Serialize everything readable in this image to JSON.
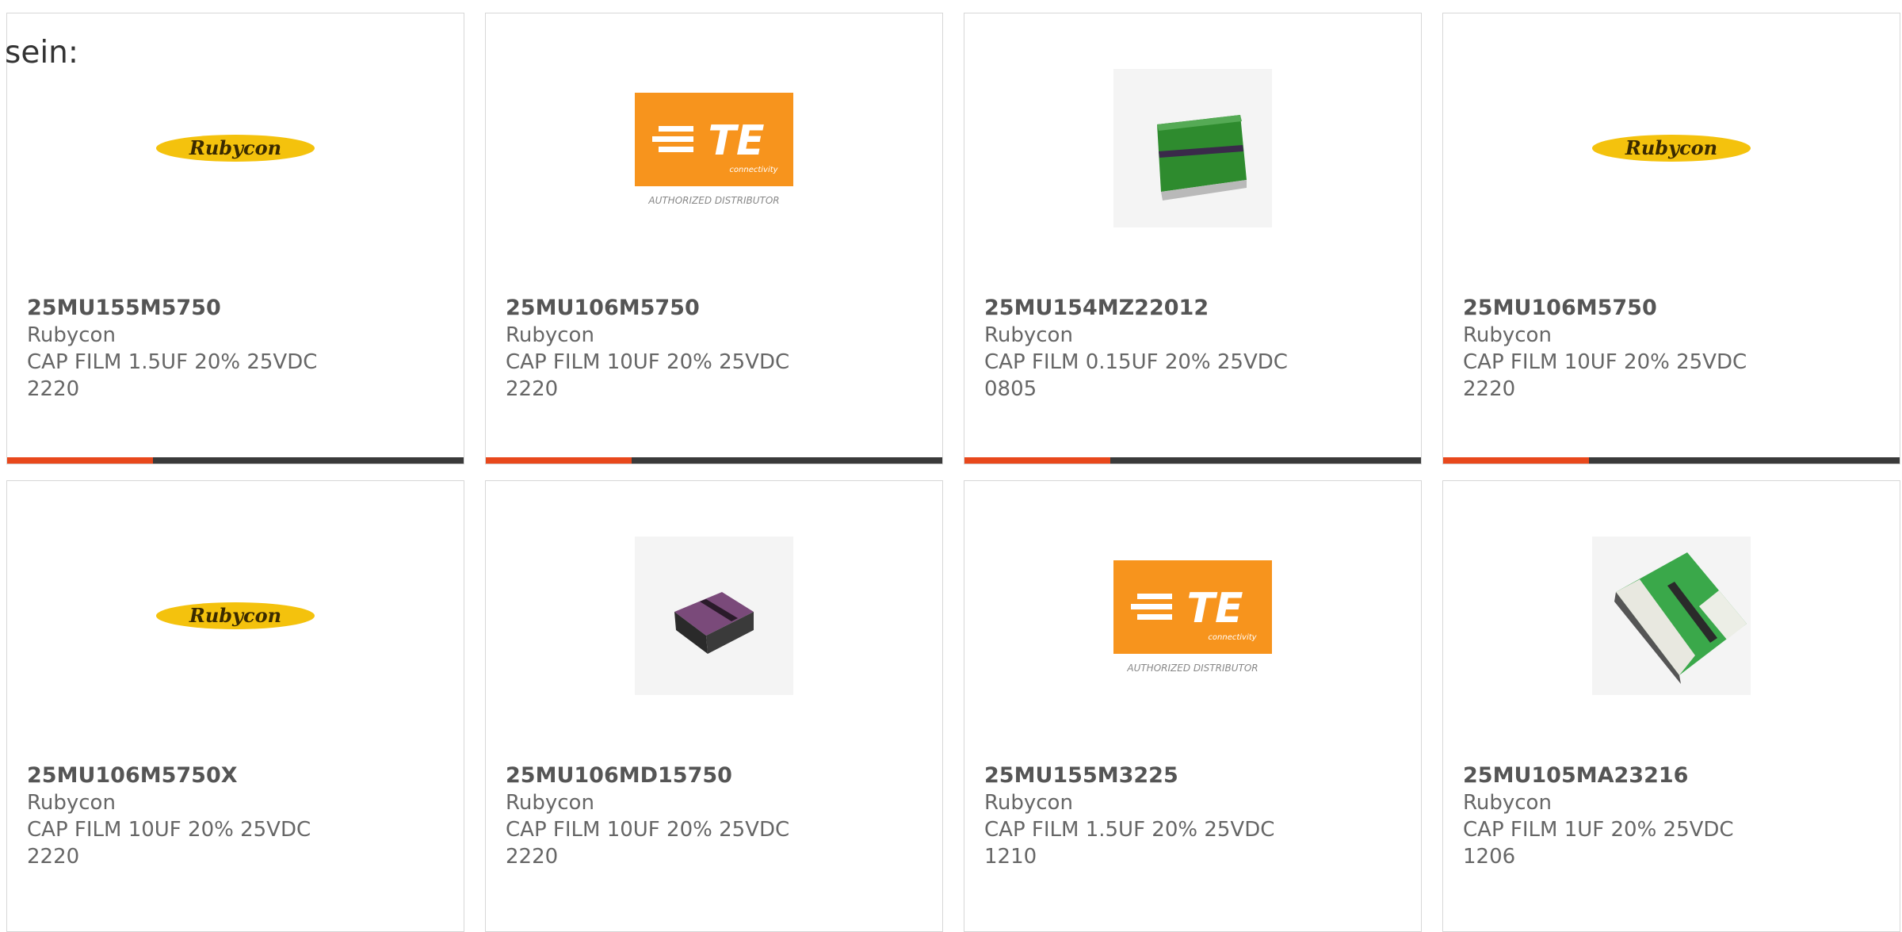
{
  "lead_text": "sein:",
  "colors": {
    "accent_bar": "#e8481c",
    "track_bar": "#3a3a3a",
    "te_orange": "#f7941d",
    "rubycon_yellow": "#f4c20d"
  },
  "logo_text": {
    "rubycon": "Rubycon",
    "te": "TE",
    "te_sub": "connectivity",
    "te_caption": "AUTHORIZED DISTRIBUTOR"
  },
  "products": [
    {
      "part_number": "25MU155M5750",
      "manufacturer": "Rubycon",
      "description": "CAP FILM 1.5UF 20% 25VDC 2220",
      "image": "rubycon-logo",
      "progress": 0.32
    },
    {
      "part_number": "25MU106M5750",
      "manufacturer": "Rubycon",
      "description": "CAP FILM 10UF 20% 25VDC 2220",
      "image": "te-logo",
      "progress": 0.32
    },
    {
      "part_number": "25MU154MZ22012",
      "manufacturer": "Rubycon",
      "description": "CAP FILM 0.15UF 20% 25VDC 0805",
      "image": "green-chip-square",
      "progress": 0.32
    },
    {
      "part_number": "25MU106M5750",
      "manufacturer": "Rubycon",
      "description": "CAP FILM 10UF 20% 25VDC 2220",
      "image": "rubycon-logo",
      "progress": 0.32
    },
    {
      "part_number": "25MU106M5750X",
      "manufacturer": "Rubycon",
      "description": "CAP FILM 10UF 20% 25VDC 2220",
      "image": "rubycon-logo"
    },
    {
      "part_number": "25MU106MD15750",
      "manufacturer": "Rubycon",
      "description": "CAP FILM 10UF 20% 25VDC 2220",
      "image": "purple-chip"
    },
    {
      "part_number": "25MU155M3225",
      "manufacturer": "Rubycon",
      "description": "CAP FILM 1.5UF 20% 25VDC 1210",
      "image": "te-logo"
    },
    {
      "part_number": "25MU105MA23216",
      "manufacturer": "Rubycon",
      "description": "CAP FILM 1UF 20% 25VDC 1206",
      "image": "green-chip-long"
    }
  ]
}
